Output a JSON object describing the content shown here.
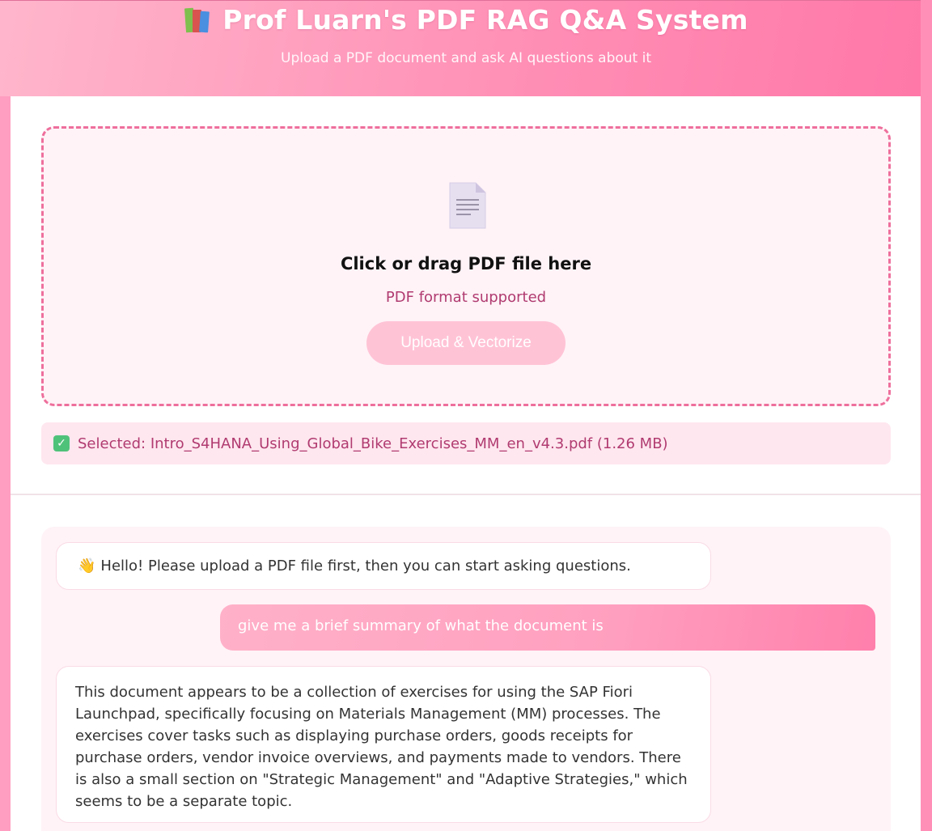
{
  "header": {
    "icon": "books-icon",
    "title": "Prof Luarn's PDF RAG Q&A System",
    "subtitle": "Upload a PDF document and ask AI questions about it"
  },
  "upload": {
    "icon": "document-icon",
    "title": "Click or drag PDF file here",
    "subtitle": "PDF format supported",
    "button_label": "Upload & Vectorize"
  },
  "selected_file": {
    "icon": "check-icon",
    "text": "Selected: Intro_S4HANA_Using_Global_Bike_Exercises_MM_en_v4.3.pdf (1.26 MB)"
  },
  "chat": {
    "messages": [
      {
        "role": "assistant",
        "icon": "wave-icon",
        "text": "Hello! Please upload a PDF file first, then you can start asking questions."
      },
      {
        "role": "user",
        "text": "give me a brief summary of what the document is"
      },
      {
        "role": "assistant",
        "text": "This document appears to be a collection of exercises for using the SAP Fiori Launchpad, specifically focusing on Materials Management (MM) processes. The exercises cover tasks such as displaying purchase orders, goods receipts for purchase orders, vendor invoice overviews, and payments made to vendors. There is also a small section on \"Strategic Management\" and \"Adaptive Strategies,\" which seems to be a separate topic."
      }
    ]
  },
  "colors": {
    "accent": "#ff8fb6",
    "accent_text": "#b03b70",
    "dashed_border": "#ee6f9c",
    "panel_bg": "#fff3f7"
  }
}
